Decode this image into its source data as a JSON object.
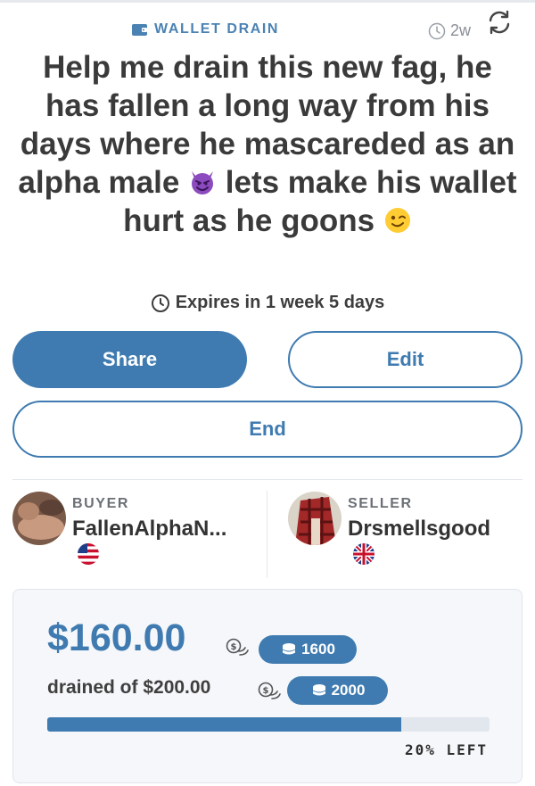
{
  "listing": {
    "category": "WALLET DRAIN",
    "age": "2w",
    "title_parts": [
      "Help me drain this new fag, he has fallen a long way from his days where he mascareded as an alpha male ",
      " lets make his wallet hurt as he goons "
    ],
    "expires": "Expires in 1 week 5 days"
  },
  "actions": {
    "share_label": "Share",
    "edit_label": "Edit",
    "end_label": "End"
  },
  "buyer": {
    "role": "BUYER",
    "name": "FallenAlphaN..."
  },
  "seller": {
    "role": "SELLER",
    "name": "Drsmellsgood"
  },
  "drain": {
    "amount": "$160.00",
    "amount_coins": "1600",
    "drained_text": "drained of $200.00",
    "goal_coins": "2000",
    "progress_fraction": 0.8,
    "left_label": "20% LEFT"
  },
  "colors": {
    "accent": "#3f7bb0",
    "card_bg": "#f5f7fa"
  },
  "icons": {
    "category": "wallet-icon",
    "age": "clock-icon",
    "refresh": "refresh-icon",
    "expires": "clock-icon",
    "coins": "coin-icon",
    "pill": "coin-stack-icon",
    "emoji_1": "smiling-devil-emoji",
    "emoji_2": "winking-face-emoji"
  }
}
